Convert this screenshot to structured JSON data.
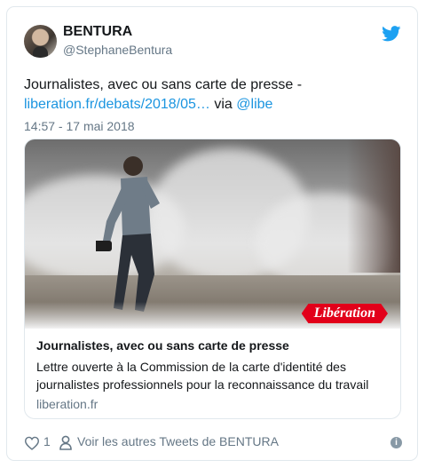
{
  "author": {
    "name": "BENTURA",
    "handle": "@StephaneBentura",
    "avatar_icon": "profile-photo"
  },
  "tweet": {
    "text_before": "Journalistes, avec ou sans carte de presse - ",
    "link": "liberation.fr/debats/2018/05…",
    "text_mid": " via ",
    "mention": "@libe",
    "timestamp": "14:57 - 17 mai 2018"
  },
  "card": {
    "title": "Journalistes, avec ou sans carte de presse",
    "description": "Lettre ouverte à la Commission de la carte d'identité des journalistes professionnels pour la reconnaissance du travail",
    "domain": "liberation.fr",
    "logo_text": "Libération"
  },
  "footer": {
    "like_count": "1",
    "others_label": "Voir les autres Tweets de BENTURA"
  },
  "icons": {
    "brand": "twitter-bird-icon",
    "like": "heart-icon",
    "profile": "person-icon",
    "info": "info-icon"
  },
  "colors": {
    "accent": "#1da1f2",
    "link": "#1b95e0",
    "muted": "#657786",
    "logo_red": "#e2001a"
  }
}
